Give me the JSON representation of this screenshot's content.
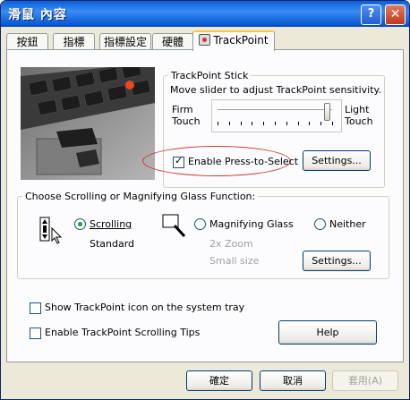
{
  "window": {
    "title": "滑鼠 內容",
    "help_glyph": "?",
    "close_glyph": "✕"
  },
  "tabs": [
    {
      "label": "按鈕"
    },
    {
      "label": "指標"
    },
    {
      "label": "指標設定"
    },
    {
      "label": "硬體"
    },
    {
      "label": "TrackPoint",
      "active": true
    }
  ],
  "stick": {
    "group_label": "TrackPoint Stick",
    "instruction": "Move slider to adjust TrackPoint sensitivity.",
    "left_label_1": "Firm",
    "left_label_2": "Touch",
    "right_label_1": "Light",
    "right_label_2": "Touch",
    "slider_position": 0.95,
    "press_to_select_label": "Enable Press-to-Select",
    "press_to_select_checked": true,
    "settings_label": "Settings..."
  },
  "scroll": {
    "group_label": "Choose Scrolling or Magnifying Glass Function:",
    "scrolling_label": "Scrolling",
    "scrolling_selected": true,
    "scrolling_sub": "Standard",
    "magnify_label": "Magnifying Glass",
    "magnify_sub_1": "2x Zoom",
    "magnify_sub_2": "Small size",
    "neither_label": "Neither",
    "settings_label": "Settings..."
  },
  "options": {
    "show_icon_label": "Show TrackPoint icon on the system tray",
    "show_icon_checked": false,
    "tips_label": "Enable TrackPoint Scrolling Tips",
    "tips_checked": false,
    "help_label": "Help"
  },
  "footer": {
    "ok_label": "確定",
    "cancel_label": "取消",
    "apply_label": "套用(A)"
  },
  "colors": {
    "title_bar": "#0a5fd8",
    "dialog_bg": "#ece9d8",
    "highlight_ellipse": "#c0392b",
    "radio_dot": "#21a121"
  }
}
